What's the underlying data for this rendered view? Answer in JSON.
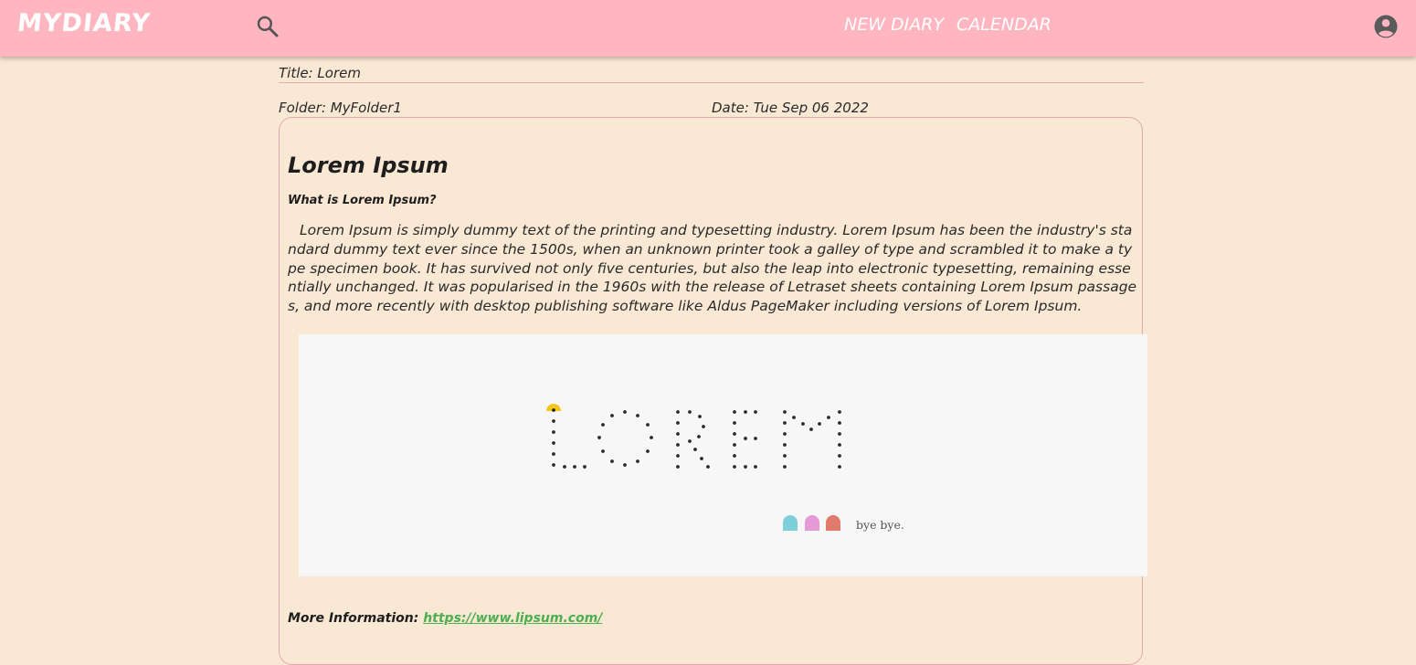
{
  "app": {
    "logo": "MYDIARY"
  },
  "nav": {
    "new_diary": "NEW DIARY",
    "calendar": "CALENDAR"
  },
  "icons": {
    "search": "search-icon",
    "account": "account-circle-icon"
  },
  "diary": {
    "title": "Title: Lorem",
    "folder": "Folder: MyFolder1",
    "date": "Date: Tue Sep 06 2022",
    "heading": "Lorem Ipsum",
    "subheading": "What is Lorem Ipsum?",
    "body": "Lorem Ipsum is simply dummy text of the printing and typesetting industry. Lorem Ipsum has been the industry's standard dummy text ever since the 1500s, when an unknown printer took a galley of type and scrambled it to make a type specimen book. It has survived not only five centuries, but also the leap into electronic typesetting, remaining essentially unchanged. It was popularised in the 1960s with the release of Letraset sheets containing Lorem Ipsum passages, and more recently with desktop publishing software like Aldus PageMaker including versions of Lorem Ipsum.",
    "image_text": "bye bye.",
    "more_label": "More Information:",
    "more_link": "https://www.lipsum.com/"
  },
  "colors": {
    "topbar": "#ffb6c1",
    "background": "#f9e8d4",
    "border": "#e3a8b0",
    "link": "#4caf50",
    "pacman": "#f5c518",
    "ghost_1": "#7ecfdc",
    "ghost_2": "#e39ad6",
    "ghost_3": "#e07b6b"
  }
}
